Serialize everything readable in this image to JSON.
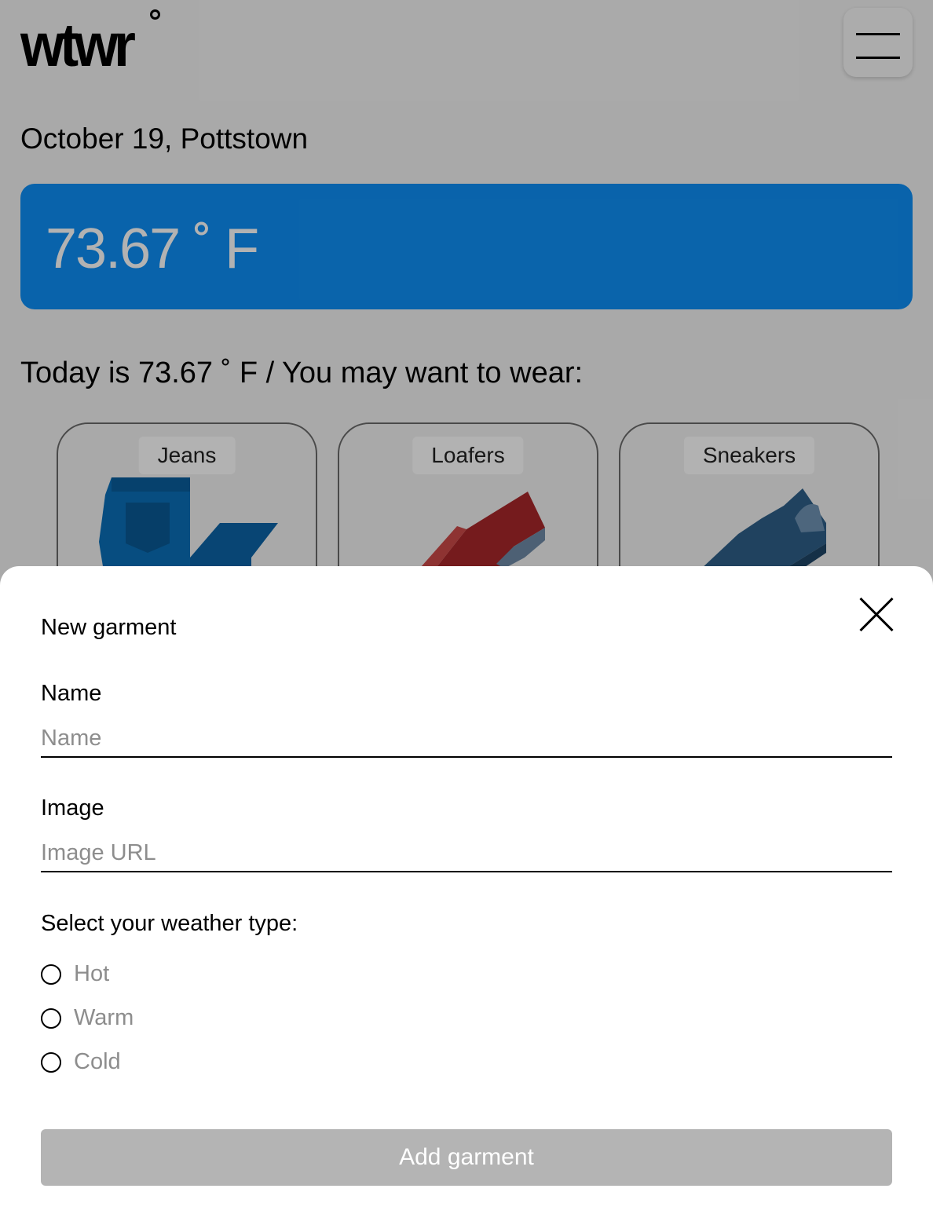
{
  "app": {
    "logo_text": "wtwr",
    "menu_icon": "hamburger-icon"
  },
  "weather": {
    "date_location": "October 19, Pottstown",
    "temperature": "73.67 ˚ F",
    "card_color": "#0e8ff5"
  },
  "recommendations": {
    "heading": "Today is 73.67 ˚ F / You may want to wear:",
    "items": [
      {
        "label": "Jeans",
        "icon": "jeans-icon",
        "color": "#0b6fb8"
      },
      {
        "label": "Loafers",
        "icon": "loafer-icon",
        "color": "#b8282a"
      },
      {
        "label": "Sneakers",
        "icon": "sneaker-icon",
        "color": "#2e5f88"
      }
    ]
  },
  "modal": {
    "title": "New garment",
    "close_icon": "close-icon",
    "name_label": "Name",
    "name_placeholder": "Name",
    "name_value": "",
    "image_label": "Image",
    "image_placeholder": "Image URL",
    "image_value": "",
    "weather_type_heading": "Select your weather type:",
    "weather_options": [
      {
        "label": "Hot",
        "selected": false
      },
      {
        "label": "Warm",
        "selected": false
      },
      {
        "label": "Cold",
        "selected": false
      }
    ],
    "submit_label": "Add garment",
    "submit_color": "#b4b4b4"
  }
}
